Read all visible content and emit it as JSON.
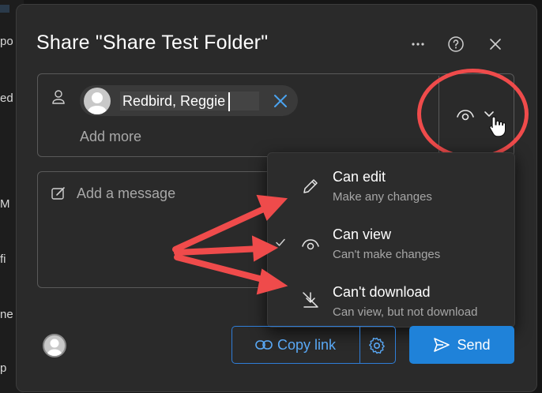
{
  "background": {
    "fragments": [
      "po",
      "ed",
      "M",
      "fi",
      "ne",
      "p"
    ]
  },
  "dialog": {
    "title": "Share \"Share Test Folder\"",
    "more_icon": "ellipsis-icon",
    "help_icon": "help-circle-icon",
    "close_icon": "close-icon"
  },
  "recipients": {
    "person_icon": "person-icon",
    "chip_name": "Redbird, Reggie",
    "add_more_placeholder": "Add more"
  },
  "permission": {
    "current_icon": "eye-icon",
    "dropdown_icon": "chevron-down-icon"
  },
  "message": {
    "placeholder": "Add a message"
  },
  "menu": {
    "items": [
      {
        "title": "Can edit",
        "subtitle": "Make any changes",
        "icon": "pencil-icon",
        "checked": false
      },
      {
        "title": "Can view",
        "subtitle": "Can't make changes",
        "icon": "eye-icon",
        "checked": true
      },
      {
        "title": "Can't download",
        "subtitle": "Can view, but not download",
        "icon": "no-download-icon",
        "checked": false
      }
    ]
  },
  "footer": {
    "copy_link_label": "Copy link",
    "send_label": "Send"
  },
  "colors": {
    "accent": "#1f82d9",
    "annotation": "#ef4b4b",
    "dialog_bg": "#2a2a2a"
  }
}
